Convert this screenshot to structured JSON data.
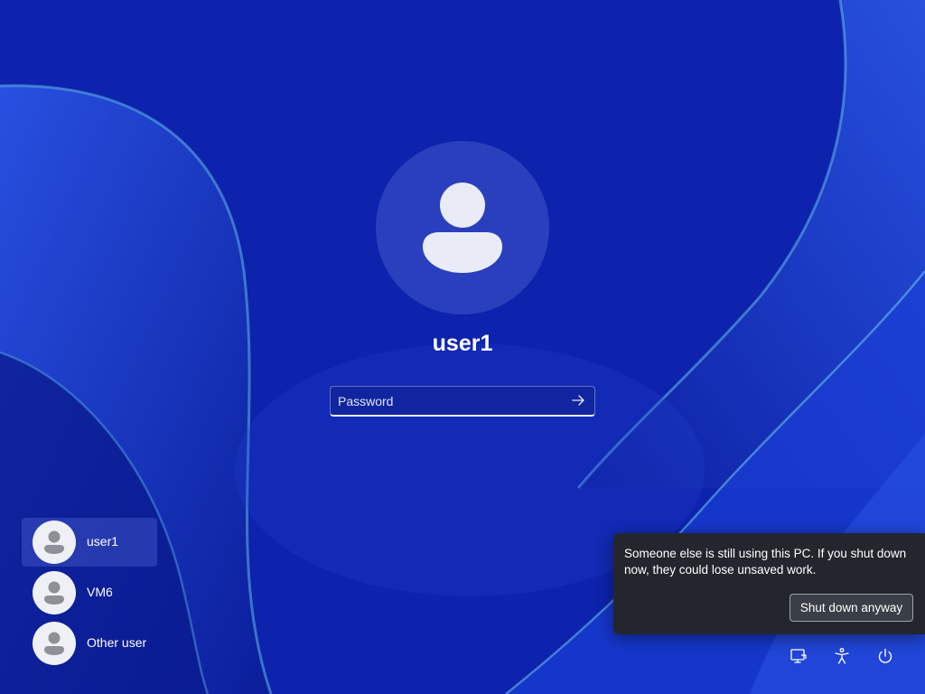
{
  "user": {
    "name": "user1",
    "avatar_icon": "person-icon"
  },
  "password": {
    "placeholder": "Password",
    "value": "",
    "submit_icon": "arrow-right-icon"
  },
  "users_list": [
    {
      "name": "user1",
      "selected": true,
      "icon": "person-icon"
    },
    {
      "name": "VM6",
      "selected": false,
      "icon": "person-icon"
    },
    {
      "name": "Other user",
      "selected": false,
      "icon": "person-icon"
    }
  ],
  "shutdown_warning": {
    "message": "Someone else is still using this PC. If you shut down now, they could lose unsaved work.",
    "button_label": "Shut down anyway"
  },
  "system_buttons": [
    {
      "icon": "network-icon"
    },
    {
      "icon": "accessibility-icon"
    },
    {
      "icon": "power-icon"
    }
  ],
  "colors": {
    "wallpaper_base": "#0f26b8",
    "flyout_bg": "#23262d",
    "text": "#ffffff"
  }
}
